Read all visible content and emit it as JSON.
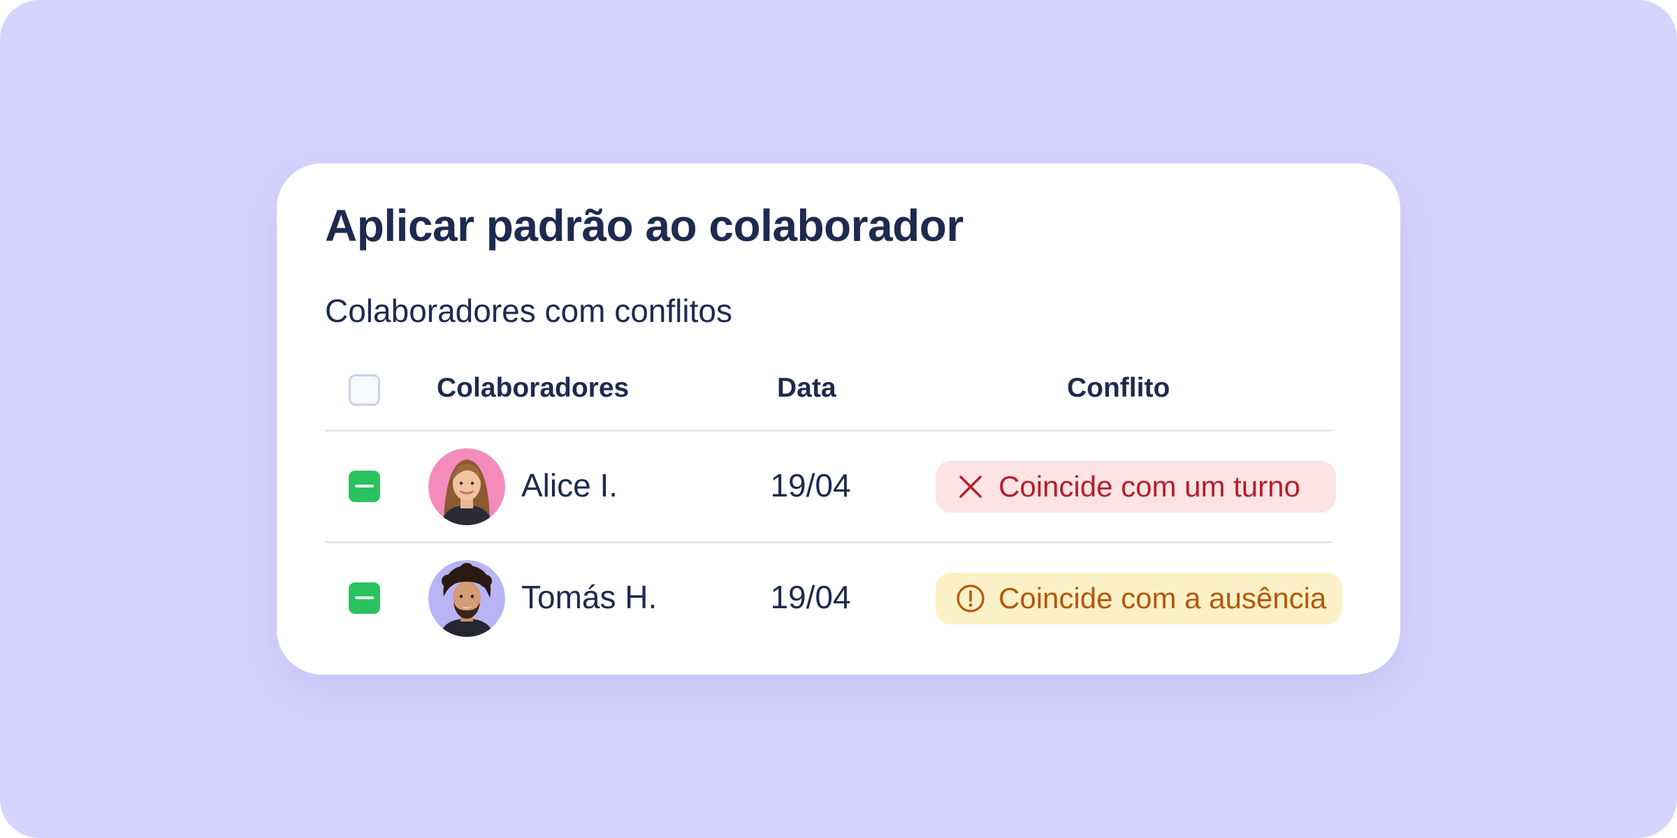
{
  "dialog": {
    "title": "Aplicar padrão ao colaborador",
    "subtitle": "Colaboradores com conflitos"
  },
  "table": {
    "headers": {
      "employees": "Colaboradores",
      "date": "Data",
      "conflict": "Conflito"
    },
    "select_all_checked": false,
    "rows": [
      {
        "name": "Alice I.",
        "date": "19/04",
        "conflict": "Coincide com um turno",
        "conflict_icon": "x-icon",
        "conflict_color": "#b5202a",
        "conflict_bg": "#fde3e4",
        "selected": true,
        "avatar_bg": "#f48bbd"
      },
      {
        "name": "Tomás H.",
        "date": "19/04",
        "conflict": "Coincide com a ausência",
        "conflict_icon": "alert-circle-icon",
        "conflict_color": "#b5560c",
        "conflict_bg": "#fcf1c6",
        "selected": true,
        "avatar_bg": "#b8b4f5"
      }
    ]
  },
  "colors": {
    "background": "#d6d3fd",
    "card": "#ffffff",
    "text": "#1e2a4f",
    "check_green": "#2ac25e"
  }
}
